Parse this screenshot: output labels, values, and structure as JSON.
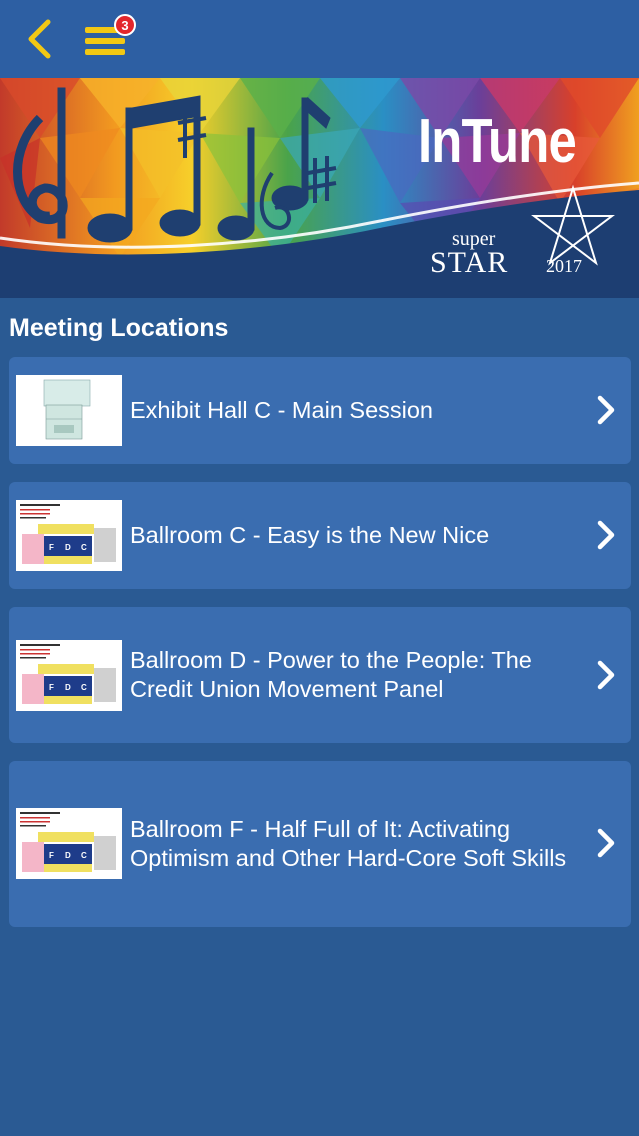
{
  "nav": {
    "back_icon": "chevron-left-icon",
    "menu_icon": "hamburger-menu-icon",
    "badge_count": "3"
  },
  "banner": {
    "title": "InTune",
    "logo_super": "super",
    "logo_star": "STAR",
    "logo_year": "2017"
  },
  "section": {
    "title": "Meeting Locations"
  },
  "locations": [
    {
      "label": "Exhibit Hall C - Main Session"
    },
    {
      "label": "Ballroom C - Easy is the New Nice"
    },
    {
      "label": "Ballroom D - Power to the People: The Credit Union Movement Panel"
    },
    {
      "label": "Ballroom F - Half Full of It: Activating Optimism and Other Hard-Core Soft Skills"
    }
  ],
  "colors": {
    "background": "#2a5a93",
    "topbar": "#2d5fa3",
    "card": "#3a6db0",
    "accent_yellow": "#f2c814",
    "badge_red": "#e3262b"
  }
}
